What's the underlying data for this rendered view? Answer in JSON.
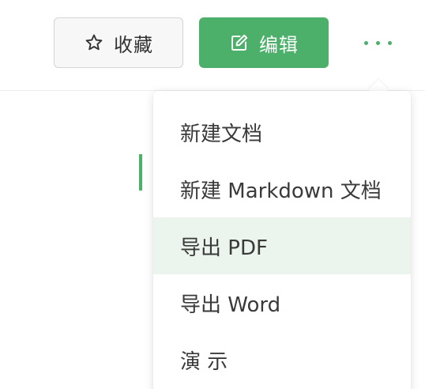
{
  "toolbar": {
    "collect_label": "收藏",
    "collect_icon": "star-outline-icon",
    "edit_label": "编辑",
    "edit_icon": "edit-pencil-icon",
    "more_icon": "more-dots-icon"
  },
  "dropdown": {
    "items": [
      {
        "label": "新建文档"
      },
      {
        "label": "新建 Markdown 文档"
      },
      {
        "label": "导出 PDF",
        "highlighted": true
      },
      {
        "label": "导出 Word"
      },
      {
        "label": "演 示"
      }
    ]
  },
  "colors": {
    "accent": "#4caf6a",
    "hover_bg": "#ebf5ed"
  }
}
